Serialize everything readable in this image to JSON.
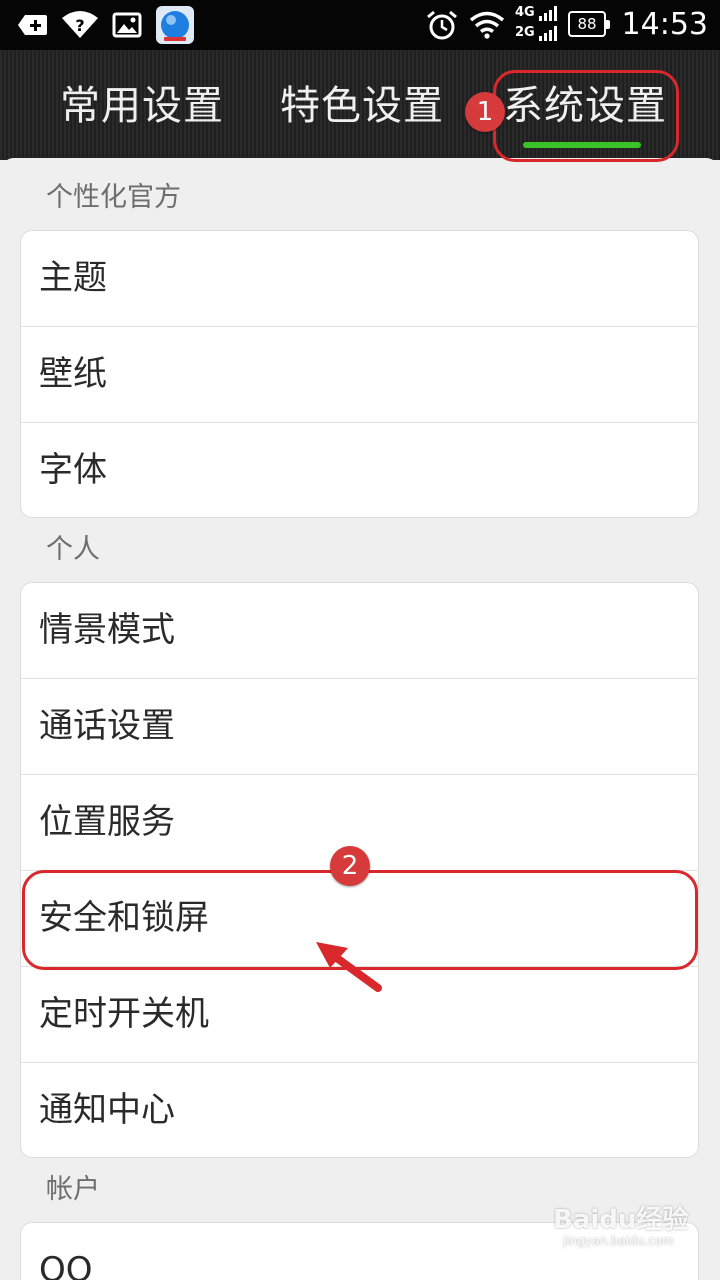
{
  "status_bar": {
    "icons": [
      "add-icon",
      "wifi-help-icon",
      "image-icon",
      "browser-app-icon",
      "alarm-icon",
      "wifi-icon",
      "signal-icon"
    ],
    "network_top": "4G",
    "network_bottom": "2G",
    "battery": "88",
    "time": "14:53"
  },
  "tabs": [
    {
      "label": "常用设置"
    },
    {
      "label": "特色设置"
    },
    {
      "label": "系统设置",
      "active": true
    }
  ],
  "annotations": {
    "badge_1": "1",
    "badge_2": "2"
  },
  "sections": [
    {
      "title": "个性化官方",
      "items": [
        "主题",
        "壁纸",
        "字体"
      ]
    },
    {
      "title": "个人",
      "items": [
        "情景模式",
        "通话设置",
        "位置服务",
        "安全和锁屏",
        "定时开关机",
        "通知中心"
      ]
    },
    {
      "title": "帐户",
      "items": [
        "QQ"
      ]
    }
  ],
  "watermark": {
    "main": "Baidu经验",
    "sub": "jingyan.baidu.com"
  },
  "colors": {
    "accent_green": "#3cc229",
    "annotation_red": "#d8282c",
    "header_dark": "#222222"
  }
}
